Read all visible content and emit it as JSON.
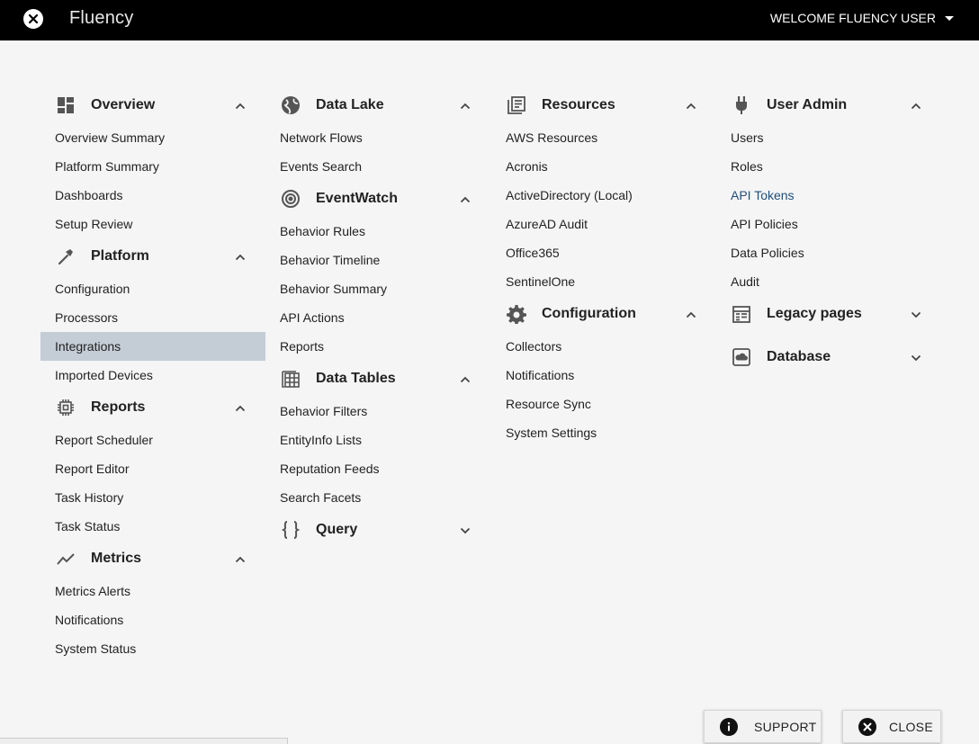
{
  "header": {
    "title": "Fluency",
    "welcome": "WELCOME FLUENCY USER"
  },
  "columns": [
    {
      "sections": [
        {
          "title": "Overview",
          "icon": "dashboard-icon",
          "expanded": true,
          "items": [
            "Overview Summary",
            "Platform Summary",
            "Dashboards",
            "Setup Review"
          ]
        },
        {
          "title": "Platform",
          "icon": "wrench-icon",
          "expanded": true,
          "items": [
            "Configuration",
            "Processors",
            "Integrations",
            "Imported Devices"
          ]
        },
        {
          "title": "Reports",
          "icon": "chip-icon",
          "expanded": true,
          "items": [
            "Report Scheduler",
            "Report Editor",
            "Task History",
            "Task Status"
          ]
        },
        {
          "title": "Metrics",
          "icon": "trend-icon",
          "expanded": true,
          "items": [
            "Metrics Alerts",
            "Notifications",
            "System Status"
          ]
        }
      ]
    },
    {
      "sections": [
        {
          "title": "Data Lake",
          "icon": "globe-icon",
          "expanded": true,
          "items": [
            "Network Flows",
            "Events Search"
          ]
        },
        {
          "title": "EventWatch",
          "icon": "target-icon",
          "expanded": true,
          "items": [
            "Behavior Rules",
            "Behavior Timeline",
            "Behavior Summary",
            "API Actions",
            "Reports"
          ]
        },
        {
          "title": "Data Tables",
          "icon": "table-icon",
          "expanded": true,
          "items": [
            "Behavior Filters",
            "EntityInfo Lists",
            "Reputation Feeds",
            "Search Facets"
          ]
        },
        {
          "title": "Query",
          "icon": "braces-icon",
          "expanded": false,
          "items": []
        }
      ]
    },
    {
      "sections": [
        {
          "title": "Resources",
          "icon": "library-icon",
          "expanded": true,
          "items": [
            "AWS Resources",
            "Acronis",
            "ActiveDirectory (Local)",
            "AzureAD Audit",
            "Office365",
            "SentinelOne"
          ]
        },
        {
          "title": "Configuration",
          "icon": "gear-icon",
          "expanded": true,
          "items": [
            "Collectors",
            "Notifications",
            "Resource Sync",
            "System Settings"
          ]
        }
      ]
    },
    {
      "sections": [
        {
          "title": "User Admin",
          "icon": "plug-icon",
          "expanded": true,
          "items": [
            "Users",
            "Roles",
            "API Tokens",
            "API Policies",
            "Data Policies",
            "Audit"
          ]
        },
        {
          "title": "Legacy pages",
          "icon": "calendar-icon",
          "expanded": false,
          "items": []
        },
        {
          "title": "Database",
          "icon": "cloud-box-icon",
          "expanded": false,
          "items": []
        }
      ]
    }
  ],
  "selected_item": "Integrations",
  "active_link": "API Tokens",
  "footer": {
    "support_label": "SUPPORT",
    "close_label": "CLOSE"
  }
}
